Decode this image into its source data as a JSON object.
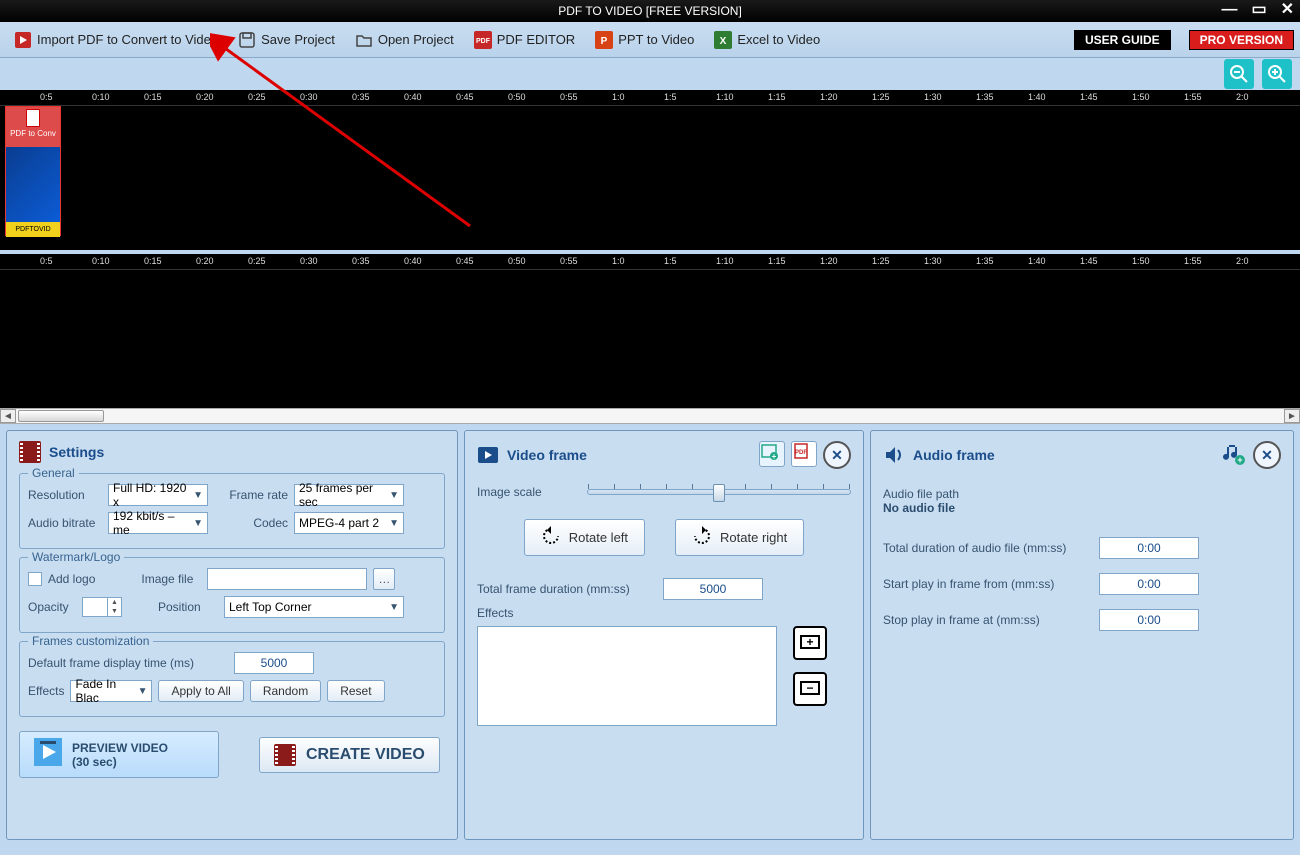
{
  "title": "PDF TO VIDEO [FREE VERSION]",
  "toolbar": {
    "import": "Import PDF to Convert to Video",
    "save": "Save Project",
    "open": "Open Project",
    "pdfeditor": "PDF EDITOR",
    "ppt": "PPT to Video",
    "excel": "Excel to Video",
    "guide": "USER GUIDE",
    "pro": "PRO VERSION"
  },
  "ruler": [
    "0:5",
    "0:10",
    "0:15",
    "0:20",
    "0:25",
    "0:30",
    "0:35",
    "0:40",
    "0:45",
    "0:50",
    "0:55",
    "1:0",
    "1:5",
    "1:10",
    "1:15",
    "1:20",
    "1:25",
    "1:30",
    "1:35",
    "1:40",
    "1:45",
    "1:50",
    "1:55",
    "2:0"
  ],
  "clip": {
    "title": "PDF to Conv",
    "caption": "PDFTOVID"
  },
  "settings": {
    "title": "Settings",
    "general": {
      "legend": "General",
      "resolution_lbl": "Resolution",
      "resolution": "Full HD: 1920 x",
      "framerate_lbl": "Frame rate",
      "framerate": "25 frames per sec",
      "bitrate_lbl": "Audio bitrate",
      "bitrate": "192 kbit/s – me",
      "codec_lbl": "Codec",
      "codec": "MPEG-4 part 2"
    },
    "watermark": {
      "legend": "Watermark/Logo",
      "addlogo": "Add logo",
      "imagefile": "Image file",
      "opacity": "Opacity",
      "position_lbl": "Position",
      "position": "Left Top Corner"
    },
    "frames": {
      "legend": "Frames customization",
      "default_lbl": "Default frame display time (ms)",
      "default_val": "5000",
      "effects_lbl": "Effects",
      "effects_val": "Fade In Blac",
      "apply": "Apply to All",
      "random": "Random",
      "reset": "Reset"
    },
    "preview": {
      "l1": "PREVIEW VIDEO",
      "l2": "(30 sec)"
    },
    "create": "CREATE VIDEO"
  },
  "video": {
    "title": "Video frame",
    "scale": "Image scale",
    "rotleft": "Rotate left",
    "rotright": "Rotate right",
    "duration_lbl": "Total frame duration (mm:ss)",
    "duration_val": "5000",
    "effects": "Effects"
  },
  "audio": {
    "title": "Audio frame",
    "path_lbl": "Audio file path",
    "path_val": "No audio file",
    "total_lbl": "Total duration of audio file (mm:ss)",
    "total_val": "0:00",
    "start_lbl": "Start play in frame from (mm:ss)",
    "start_val": "0:00",
    "stop_lbl": "Stop play in frame at (mm:ss)",
    "stop_val": "0:00"
  }
}
